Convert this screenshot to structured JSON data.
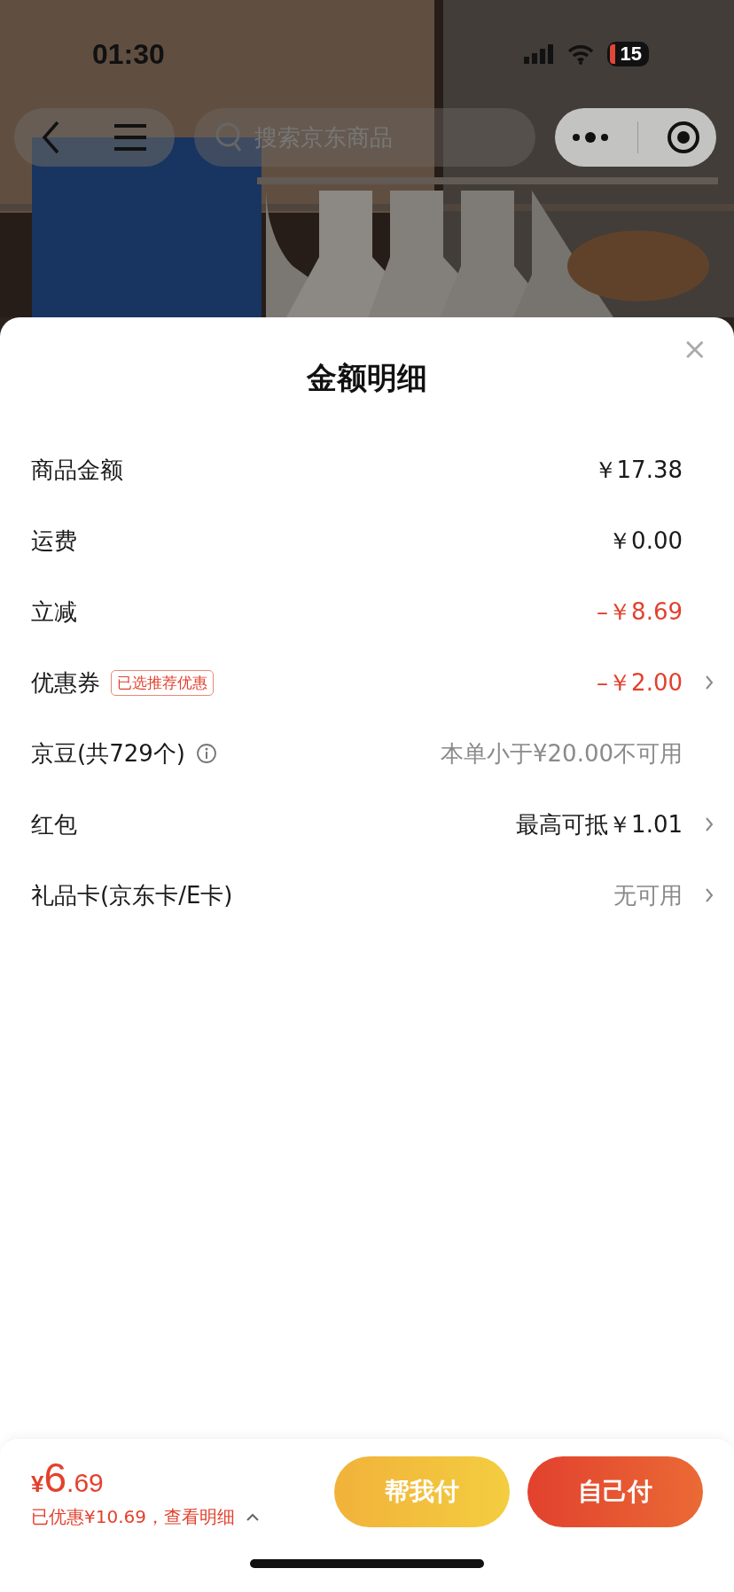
{
  "status_bar": {
    "time": "01:30",
    "battery": "15"
  },
  "nav": {
    "search_placeholder": "搜索京东商品"
  },
  "sheet": {
    "title": "金额明细",
    "close": "×",
    "rows": [
      {
        "label": "商品金额",
        "value": "￥17.38",
        "kind": "normal",
        "arrow": false
      },
      {
        "label": "运费",
        "value": "￥0.00",
        "kind": "normal",
        "arrow": false
      },
      {
        "label": "立减",
        "value": "–￥8.69",
        "kind": "discount",
        "arrow": false
      },
      {
        "label": "优惠券",
        "badge": "已选推荐优惠",
        "value": "–￥2.00",
        "kind": "discount",
        "arrow": true
      },
      {
        "label": "京豆(共729个)",
        "info": true,
        "value": "本单小于¥20.00不可用",
        "kind": "muted",
        "arrow": false
      },
      {
        "label": "红包",
        "value": "最高可抵￥1.01",
        "kind": "normal",
        "arrow": true
      },
      {
        "label": "礼品卡(京东卡/E卡)",
        "value": "无可用",
        "kind": "muted",
        "arrow": true
      }
    ]
  },
  "footer": {
    "currency": "¥",
    "integer": "6",
    "decimal": ".69",
    "saving": "已优惠¥10.69，查看明细",
    "buttons": [
      {
        "label": "帮我付",
        "kind": "secondary"
      },
      {
        "label": "自己付",
        "kind": "primary"
      }
    ]
  }
}
